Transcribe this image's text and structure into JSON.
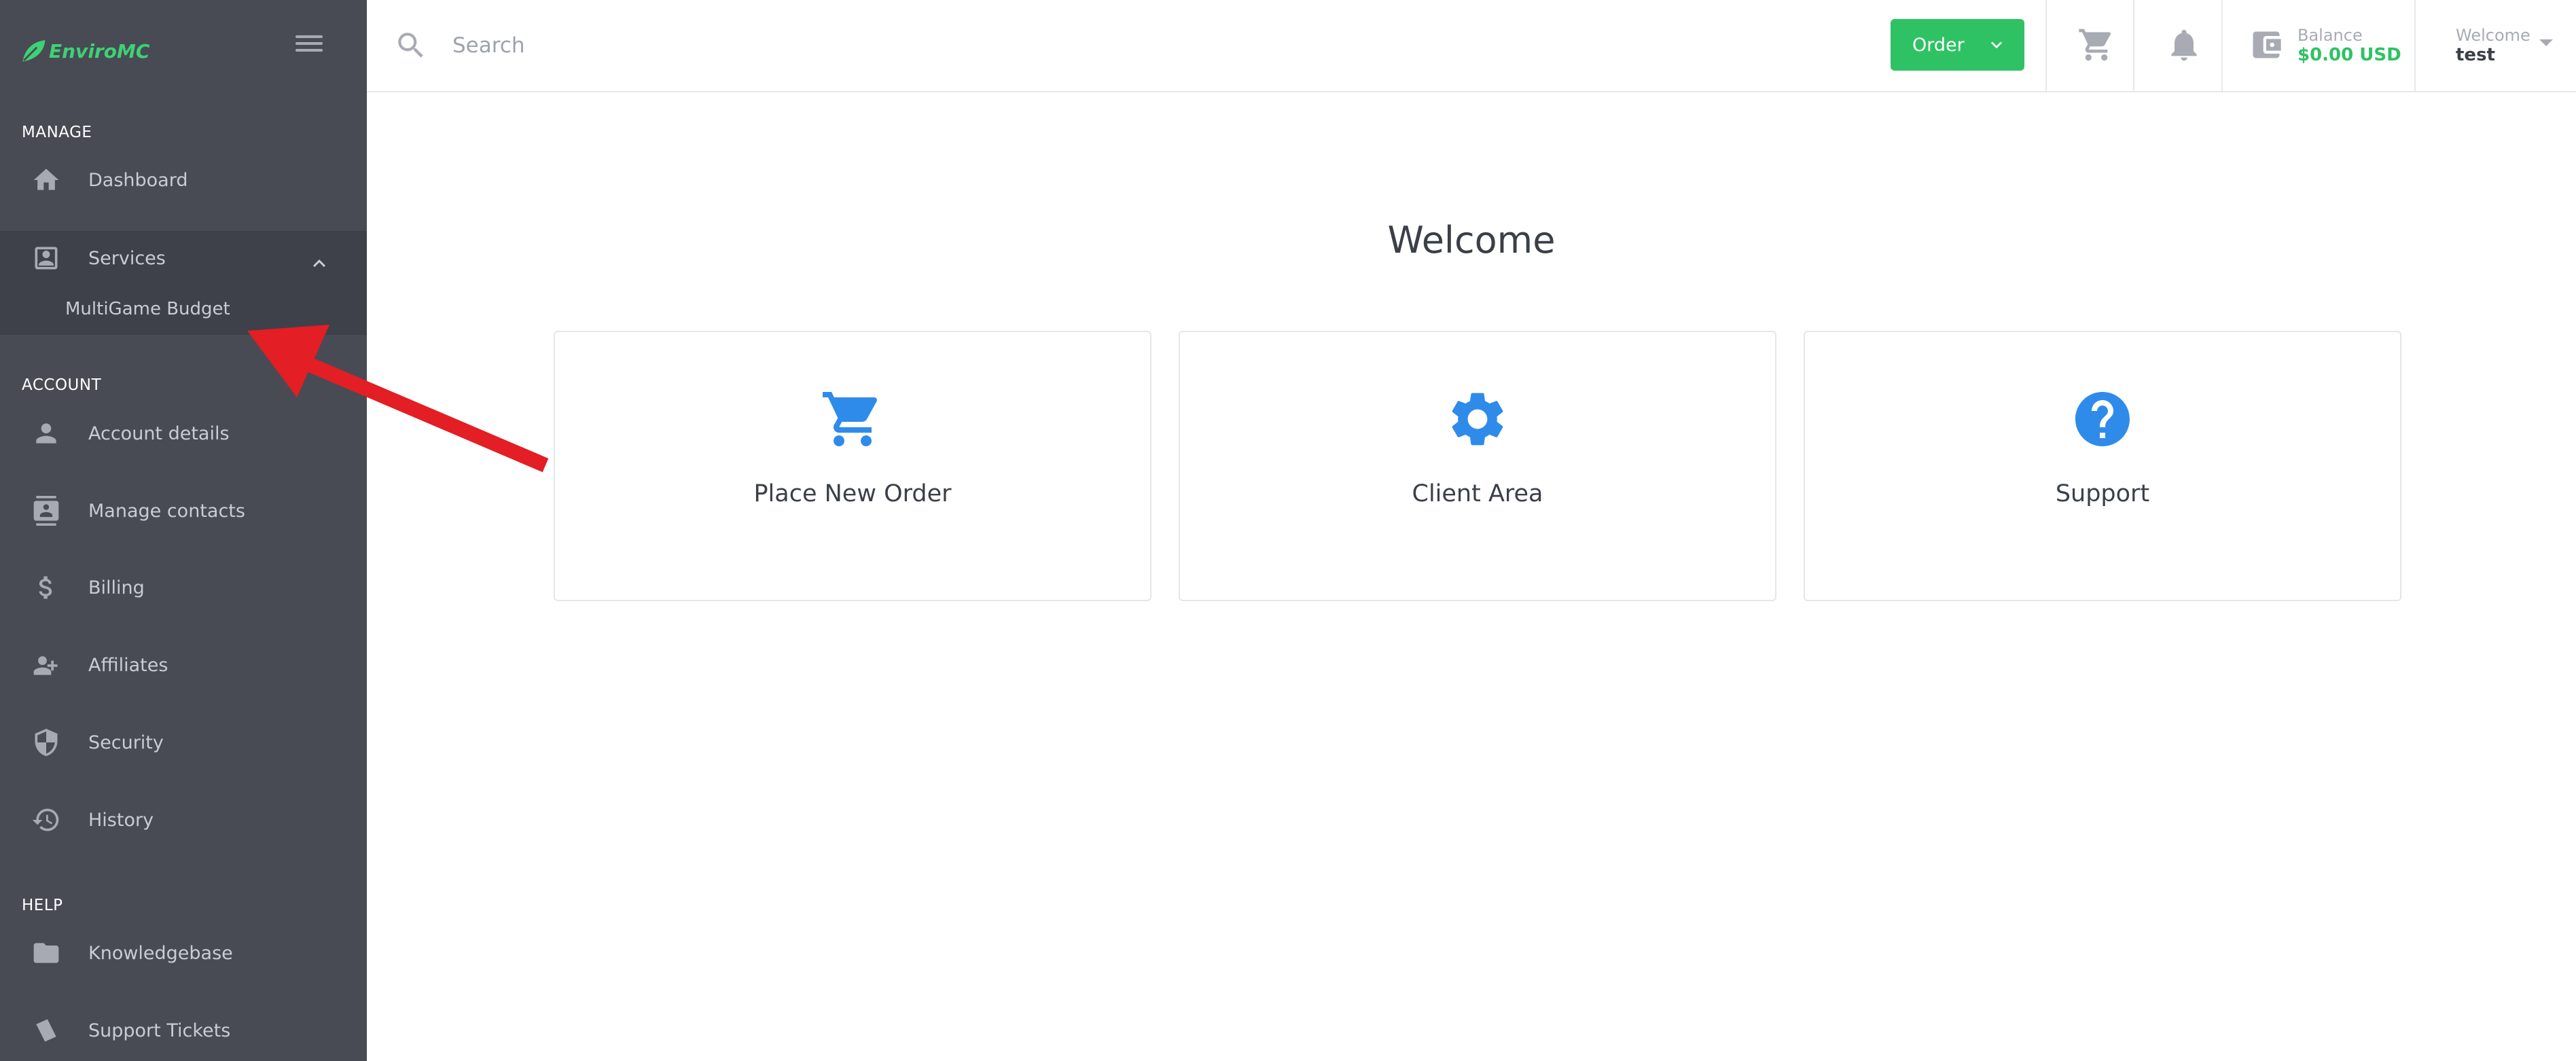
{
  "brand": {
    "name": "EnviroMC"
  },
  "sidebar": {
    "sections": {
      "manage": "MANAGE",
      "account": "ACCOUNT",
      "help": "HELP"
    },
    "items": {
      "dashboard": "Dashboard",
      "services": "Services",
      "services_sub": "MultiGame Budget",
      "account_details": "Account details",
      "manage_contacts": "Manage contacts",
      "billing": "Billing",
      "affiliates": "Affiliates",
      "security": "Security",
      "history": "History",
      "knowledgebase": "Knowledgebase",
      "support_tickets": "Support Tickets"
    }
  },
  "header": {
    "search_placeholder": "Search",
    "order_label": "Order",
    "balance_label": "Balance",
    "balance_value": "$0.00 USD",
    "welcome_label": "Welcome",
    "user_name": "test"
  },
  "main": {
    "title": "Welcome",
    "cards": {
      "order": "Place New Order",
      "client": "Client Area",
      "support": "Support"
    }
  },
  "colors": {
    "sidebar_bg": "#484b54",
    "accent_green": "#2ec264",
    "card_icon_blue": "#2f8bea",
    "annotation_red": "#e31e24"
  },
  "icons": [
    "menu-icon",
    "home-icon",
    "account-box-icon",
    "chevron-up-icon",
    "person-icon",
    "contacts-icon",
    "dollar-icon",
    "group-add-icon",
    "shield-icon",
    "history-icon",
    "folder-icon",
    "ticket-icon",
    "search-icon",
    "chevron-down-icon",
    "cart-icon",
    "bell-icon",
    "wallet-icon",
    "caret-down-icon",
    "gear-icon",
    "help-circle-icon",
    "arrow-annotation"
  ]
}
